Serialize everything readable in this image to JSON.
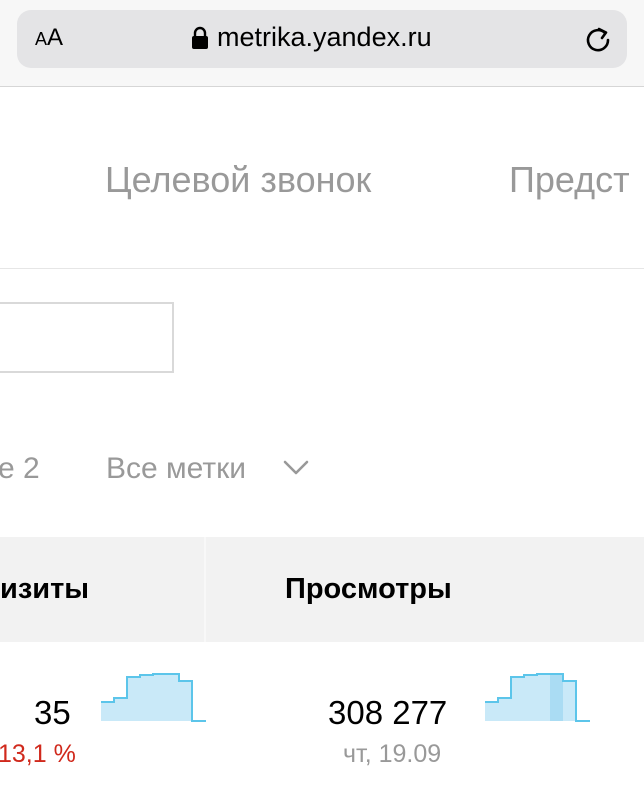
{
  "browser": {
    "text_size_label": "AA",
    "url": "metrika.yandex.ru",
    "lock_icon": "lock-icon",
    "reload_icon": "reload-icon"
  },
  "tabs": [
    {
      "label": "Целевой звонок"
    },
    {
      "label": "Предст"
    }
  ],
  "filters": {
    "partial_label": "е 2",
    "tags_label": "Все метки",
    "tags_icon": "chevron-down-icon"
  },
  "table": {
    "headers": [
      "изиты",
      "Просмотры"
    ],
    "row": {
      "visits_value": "35",
      "visits_change": "13,1 %",
      "views_value": "308 277",
      "views_date": "чт, 19.09"
    }
  },
  "colors": {
    "accent_negative": "#d0291c",
    "muted_text": "#999999",
    "spark_fill": "#c9e9f8",
    "spark_stroke": "#5cc5ea"
  }
}
